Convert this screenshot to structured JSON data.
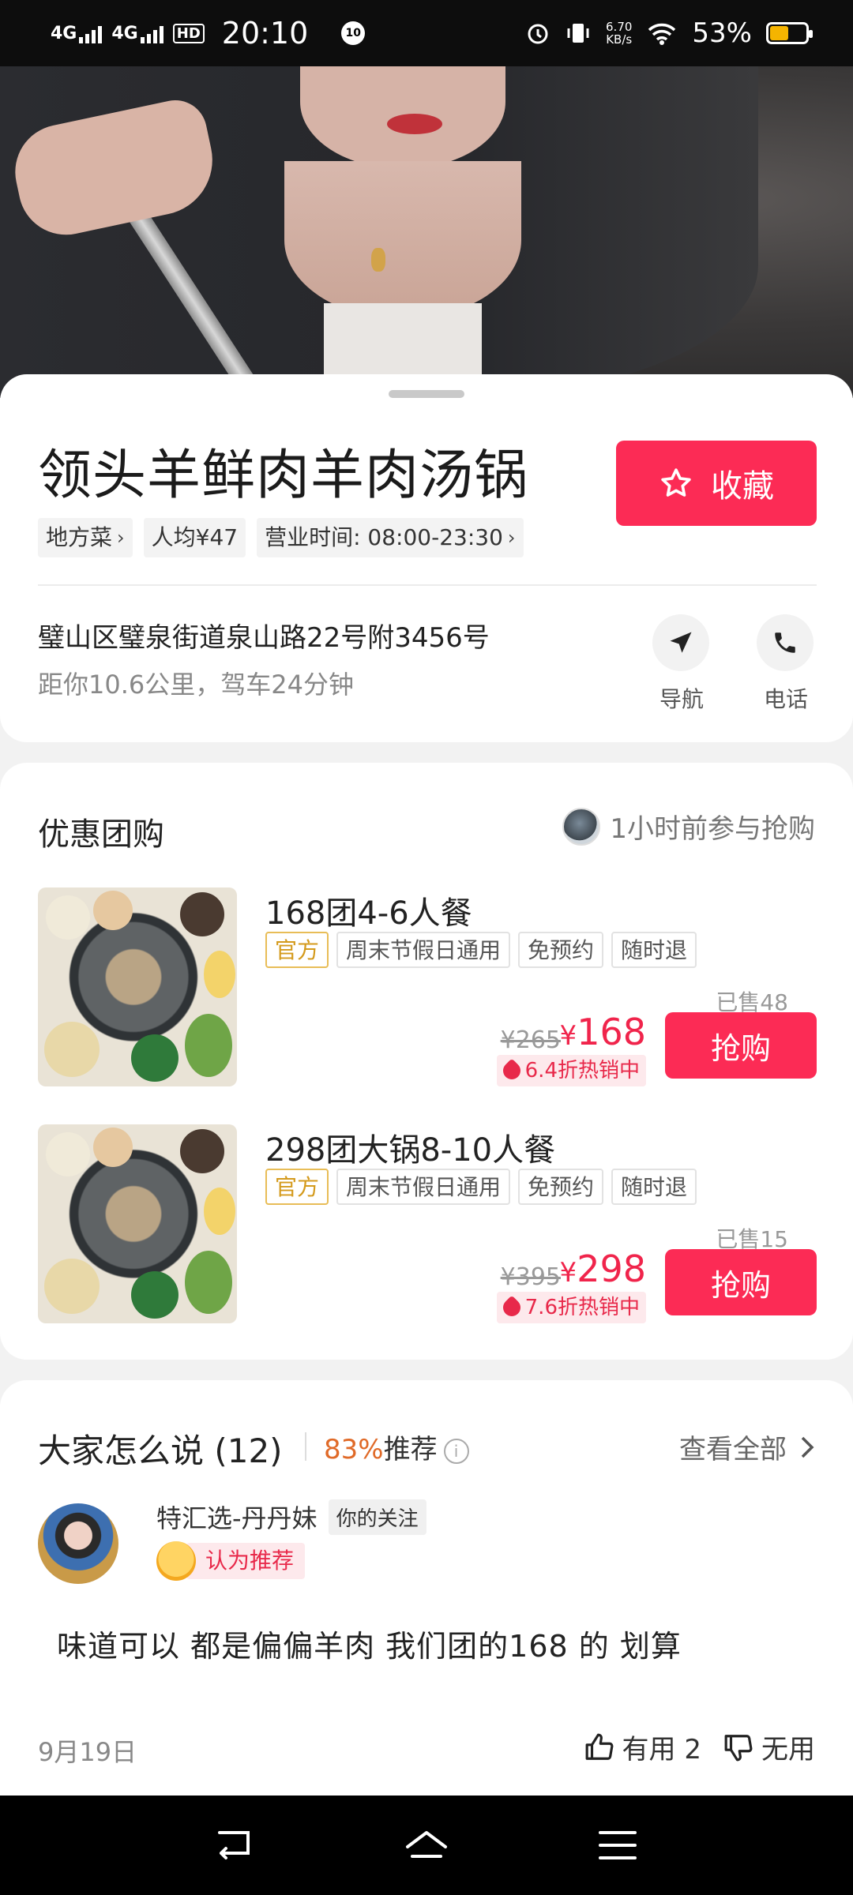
{
  "status_bar": {
    "signal1": "4G",
    "signal2": "4G",
    "hd": "HD",
    "time": "20:10",
    "notif_badge": "10",
    "speed_value": "6.70",
    "speed_unit": "KB/s",
    "battery": "53%"
  },
  "shop": {
    "name": "领头羊鲜肉羊肉汤锅",
    "favorite_label": "收藏",
    "tags": [
      "地方菜",
      "人均¥47",
      "营业时间: 08:00-23:30"
    ],
    "address": "璧山区璧泉街道泉山路22号附3456号",
    "distance": "距你10.6公里，驾车24分钟",
    "nav_label": "导航",
    "call_label": "电话"
  },
  "deals_section": {
    "title": "优惠团购",
    "recent_activity": "1小时前参与抢购",
    "deals": [
      {
        "name": "168团4-6人餐",
        "chips": [
          "官方",
          "周末节假日通用",
          "免预约",
          "随时退"
        ],
        "sold": "已售48",
        "original_price": "¥265",
        "currency": "¥",
        "price": "168",
        "discount": "6.4折热销中",
        "buy_label": "抢购"
      },
      {
        "name": "298团大锅8-10人餐",
        "chips": [
          "官方",
          "周末节假日通用",
          "免预约",
          "随时退"
        ],
        "sold": "已售15",
        "original_price": "¥395",
        "currency": "¥",
        "price": "298",
        "discount": "7.6折热销中",
        "buy_label": "抢购"
      }
    ]
  },
  "reviews": {
    "title": "大家怎么说 (12)",
    "recommend_pct": "83%",
    "recommend_label": "推荐",
    "view_all": "查看全部",
    "review": {
      "user": "特汇选-丹丹妹",
      "follow_tag": "你的关注",
      "recommend_tag": "认为推荐",
      "text": "味道可以 都是偏偏羊肉  我们团的168 的 划算",
      "date": "9月19日",
      "useful_label": "有用 2",
      "useless_label": "无用"
    }
  },
  "colors": {
    "accent": "#fc2b55",
    "price": "#f0244b",
    "official_chip": "#d49a1c",
    "recommend_pct": "#e06a28"
  }
}
